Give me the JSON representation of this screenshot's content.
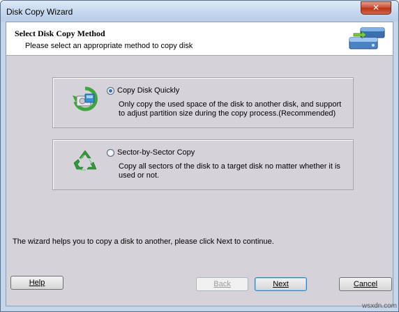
{
  "window": {
    "title": "Disk Copy Wizard",
    "close_glyph": "✕"
  },
  "header": {
    "title": "Select Disk Copy Method",
    "subtitle": "Please select an appropriate method to copy disk",
    "icon": "disk-copy-icon"
  },
  "options": [
    {
      "label": "Copy Disk Quickly",
      "selected": true,
      "icon": "disk-quick-copy-icon",
      "description": "Only copy the used space of the disk to another disk, and support to adjust partition size during the copy process.(Recommended)"
    },
    {
      "label": "Sector-by-Sector Copy",
      "selected": false,
      "icon": "recycle-icon",
      "description": "Copy all sectors of the disk to a target disk no matter whether it is used or not."
    }
  ],
  "info_text": "The wizard helps you to copy a disk to another, please click Next to continue.",
  "buttons": {
    "help": "Help",
    "back": "Back",
    "next": "Next",
    "cancel": "Cancel"
  },
  "watermark": "wsxdn.com",
  "colors": {
    "titlebar": "#c3d6ee",
    "close": "#c8462b",
    "panel": "#d5d3d9",
    "recycle_green": "#2e9a3a"
  }
}
